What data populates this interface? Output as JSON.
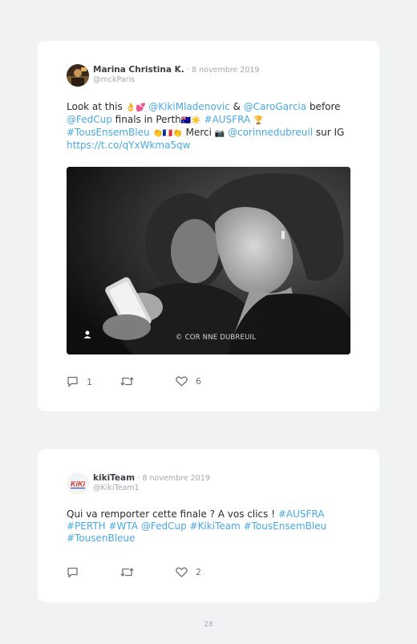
{
  "tweets": [
    {
      "author": "Marina Christina K.",
      "date": "· 8 novembre 2019",
      "handle": "@mckParis",
      "text": {
        "l1_a": "Look at this ",
        "l1_emoji": "👌💕",
        "l1_m1": "@KikiMladenovic",
        "l1_amp": " & ",
        "l1_m2": "@CaroGarcia",
        "l1_b": " before",
        "l2_m": "@FedCup",
        "l2_a": " finals in Perth",
        "l2_emoji": "🇦🇺☀️",
        "l2_tag": "#AUSFRA",
        "l2_emoji2": "🏆",
        "l3_tag": "#TousEnsemBleu",
        "l3_emoji": "👏🇫🇷👏",
        "l3_a": " Merci ",
        "l3_emoji2": "📷",
        "l3_m": "@corinnedubreuil",
        "l3_b": " sur IG",
        "l4_link": "https://t.co/qYxWkma5qw"
      },
      "photo": {
        "credit": "© COR NNE DUBREUIL",
        "user_icon": "person-icon"
      },
      "actions": {
        "replies": "1",
        "retweets": "",
        "likes": "6"
      }
    },
    {
      "author": "kikiTeam",
      "date": "· 8 novembre 2019",
      "handle": "@KikiTeam1",
      "avatar_text": "KiKi",
      "text": {
        "l1_a": "Qui va remporter cette finale ? A vos clics ! ",
        "l1_tag": "#AUSFRA",
        "l2": "#PERTH #WTA @FedCup #KikiTeam #TousEnsemBleu",
        "l3": "#TousenBleue"
      },
      "actions": {
        "replies": "",
        "retweets": "",
        "likes": "2"
      }
    }
  ],
  "page_number": "28",
  "colors": {
    "link": "#4aa8e0",
    "background": "#f1f2f4",
    "card": "#ffffff"
  }
}
